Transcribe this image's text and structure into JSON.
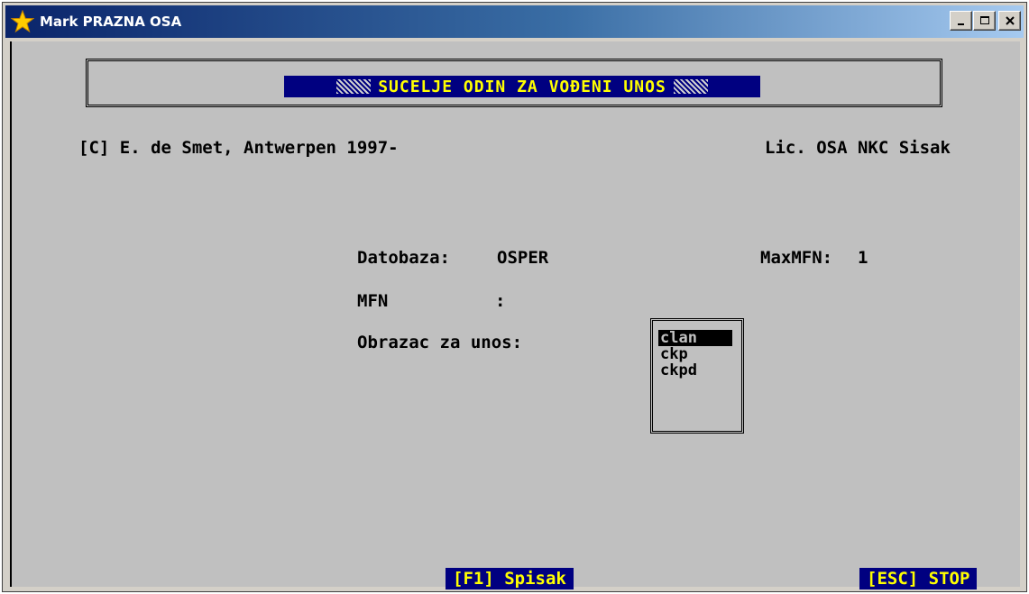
{
  "window": {
    "title": "Mark PRAZNA OSA",
    "icon": "star-icon",
    "controls": {
      "minimize_icon": "minimize-icon",
      "maximize_icon": "maximize-icon",
      "close_icon": "close-icon"
    }
  },
  "banner": {
    "title": "SUCELJE ODIN ZA VOĐENI UNOS"
  },
  "header": {
    "copyright": "[C] E. de Smet, Antwerpen 1997-",
    "license": "Lic. OSA NKC Sisak"
  },
  "fields": {
    "database_label": "Datobaza:",
    "database_value": "OSPER",
    "maxmfn_label": "MaxMFN:",
    "maxmfn_value": "1",
    "mfn_label": "MFN",
    "mfn_colon": ":",
    "form_label": "Obrazac za unos:"
  },
  "form_list": {
    "selected": "clan",
    "options": [
      "clan",
      "ckp",
      "ckpd"
    ]
  },
  "function_keys": {
    "f1": "[F1] Spisak",
    "esc": "[ESC] STOP"
  },
  "colors": {
    "background": "#c0c0c0",
    "highlight_bg": "#000080",
    "highlight_fg": "#ffff00",
    "title_gradient_start": "#0a246a",
    "title_gradient_end": "#a6caf0"
  }
}
